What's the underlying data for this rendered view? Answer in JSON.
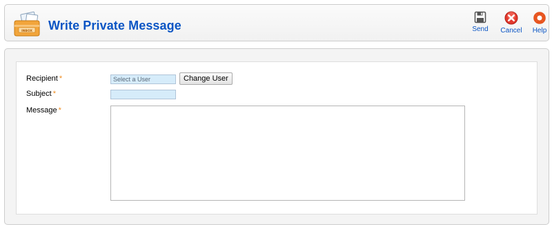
{
  "header": {
    "title": "Write Private Message",
    "icon_text": "INBOX"
  },
  "toolbar": {
    "send_label": "Send",
    "cancel_label": "Cancel",
    "help_label": "Help"
  },
  "form": {
    "recipient": {
      "label": "Recipient",
      "required_mark": "*",
      "value": "Select a User",
      "change_button_label": "Change User"
    },
    "subject": {
      "label": "Subject",
      "required_mark": "*",
      "value": ""
    },
    "message": {
      "label": "Message",
      "required_mark": "*",
      "value": ""
    }
  },
  "colors": {
    "accent": "#0b55c4",
    "required": "#ef8c20",
    "input_bg": "#d6ecfa",
    "cancel_red": "#e23a2e"
  }
}
